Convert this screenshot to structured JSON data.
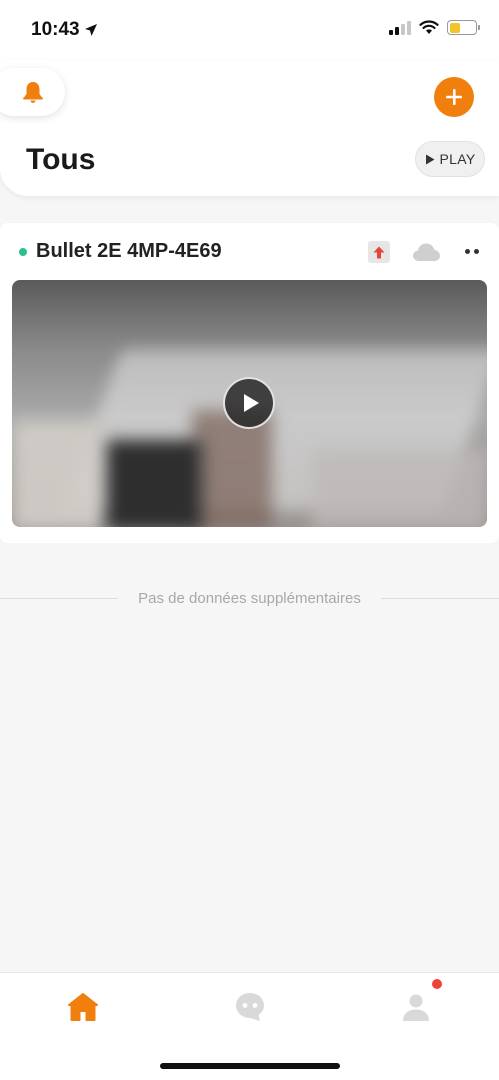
{
  "status_bar": {
    "time": "10:43",
    "battery_level": 0.4,
    "battery_color": "#f3c32b"
  },
  "header": {
    "title": "Tous",
    "play_label": "PLAY",
    "accent_color": "#f07f0e",
    "bell_icon": "bell-icon",
    "add_icon": "plus-icon"
  },
  "devices": [
    {
      "name": "Bullet 2E 4MP-4E69",
      "status": "online",
      "status_color": "#2fc08a",
      "icons": [
        "upload-alert-icon",
        "cloud-icon",
        "more-icon"
      ]
    }
  ],
  "list_footer": {
    "text": "Pas de données supplémentaires"
  },
  "bottom_nav": {
    "items": [
      {
        "icon": "home-icon",
        "active": true
      },
      {
        "icon": "messages-icon",
        "active": false
      },
      {
        "icon": "profile-icon",
        "active": false,
        "badge": true
      }
    ],
    "badge_color": "#f0413c"
  }
}
